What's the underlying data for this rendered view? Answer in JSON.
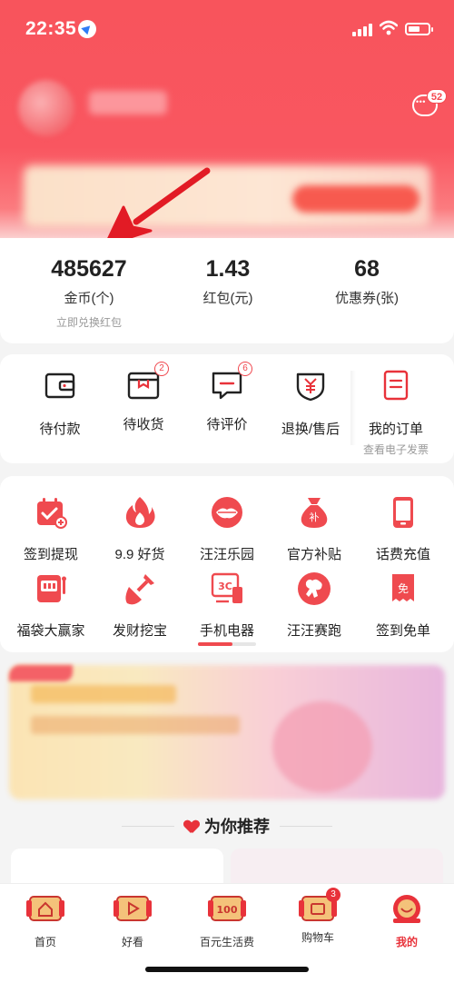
{
  "status_bar": {
    "time": "22:35"
  },
  "header": {
    "message_badge": "52"
  },
  "assets": [
    {
      "value": "485627",
      "label": "金币(个)",
      "sub": "立即兑换红包"
    },
    {
      "value": "1.43",
      "label": "红包(元)"
    },
    {
      "value": "68",
      "label": "优惠券(张)"
    }
  ],
  "orders": [
    {
      "label": "待付款",
      "icon": "wallet-icon"
    },
    {
      "label": "待收货",
      "icon": "package-icon",
      "badge": "2"
    },
    {
      "label": "待评价",
      "icon": "comment-icon",
      "badge": "6"
    },
    {
      "label": "退换/售后",
      "icon": "refund-icon"
    },
    {
      "label": "我的订单",
      "sub": "查看电子发票",
      "icon": "order-list-icon"
    }
  ],
  "services": [
    {
      "label": "签到提现",
      "icon": "calendar-icon"
    },
    {
      "label": "9.9 好货",
      "icon": "flame-icon"
    },
    {
      "label": "汪汪乐园",
      "icon": "lips-icon"
    },
    {
      "label": "官方补贴",
      "icon": "money-bag-icon"
    },
    {
      "label": "话费充值",
      "icon": "phone-icon"
    },
    {
      "label": "福袋大赢家",
      "icon": "slot-machine-icon"
    },
    {
      "label": "发财挖宝",
      "icon": "shovel-icon"
    },
    {
      "label": "手机电器",
      "icon": "electronics-icon"
    },
    {
      "label": "汪汪赛跑",
      "icon": "dog-run-icon"
    },
    {
      "label": "签到免单",
      "icon": "free-coupon-icon"
    }
  ],
  "recommend_title": "为你推荐",
  "tabbar": [
    {
      "label": "首页",
      "icon": "home-icon"
    },
    {
      "label": "好看",
      "icon": "play-icon"
    },
    {
      "label": "百元生活费",
      "icon": "hundred-icon",
      "icon_text": "100"
    },
    {
      "label": "购物车",
      "icon": "cart-icon",
      "badge": "3"
    },
    {
      "label": "我的",
      "icon": "profile-icon",
      "active": true
    }
  ],
  "colors": {
    "brand_red": "#f8545c",
    "accent": "#e8323a"
  }
}
